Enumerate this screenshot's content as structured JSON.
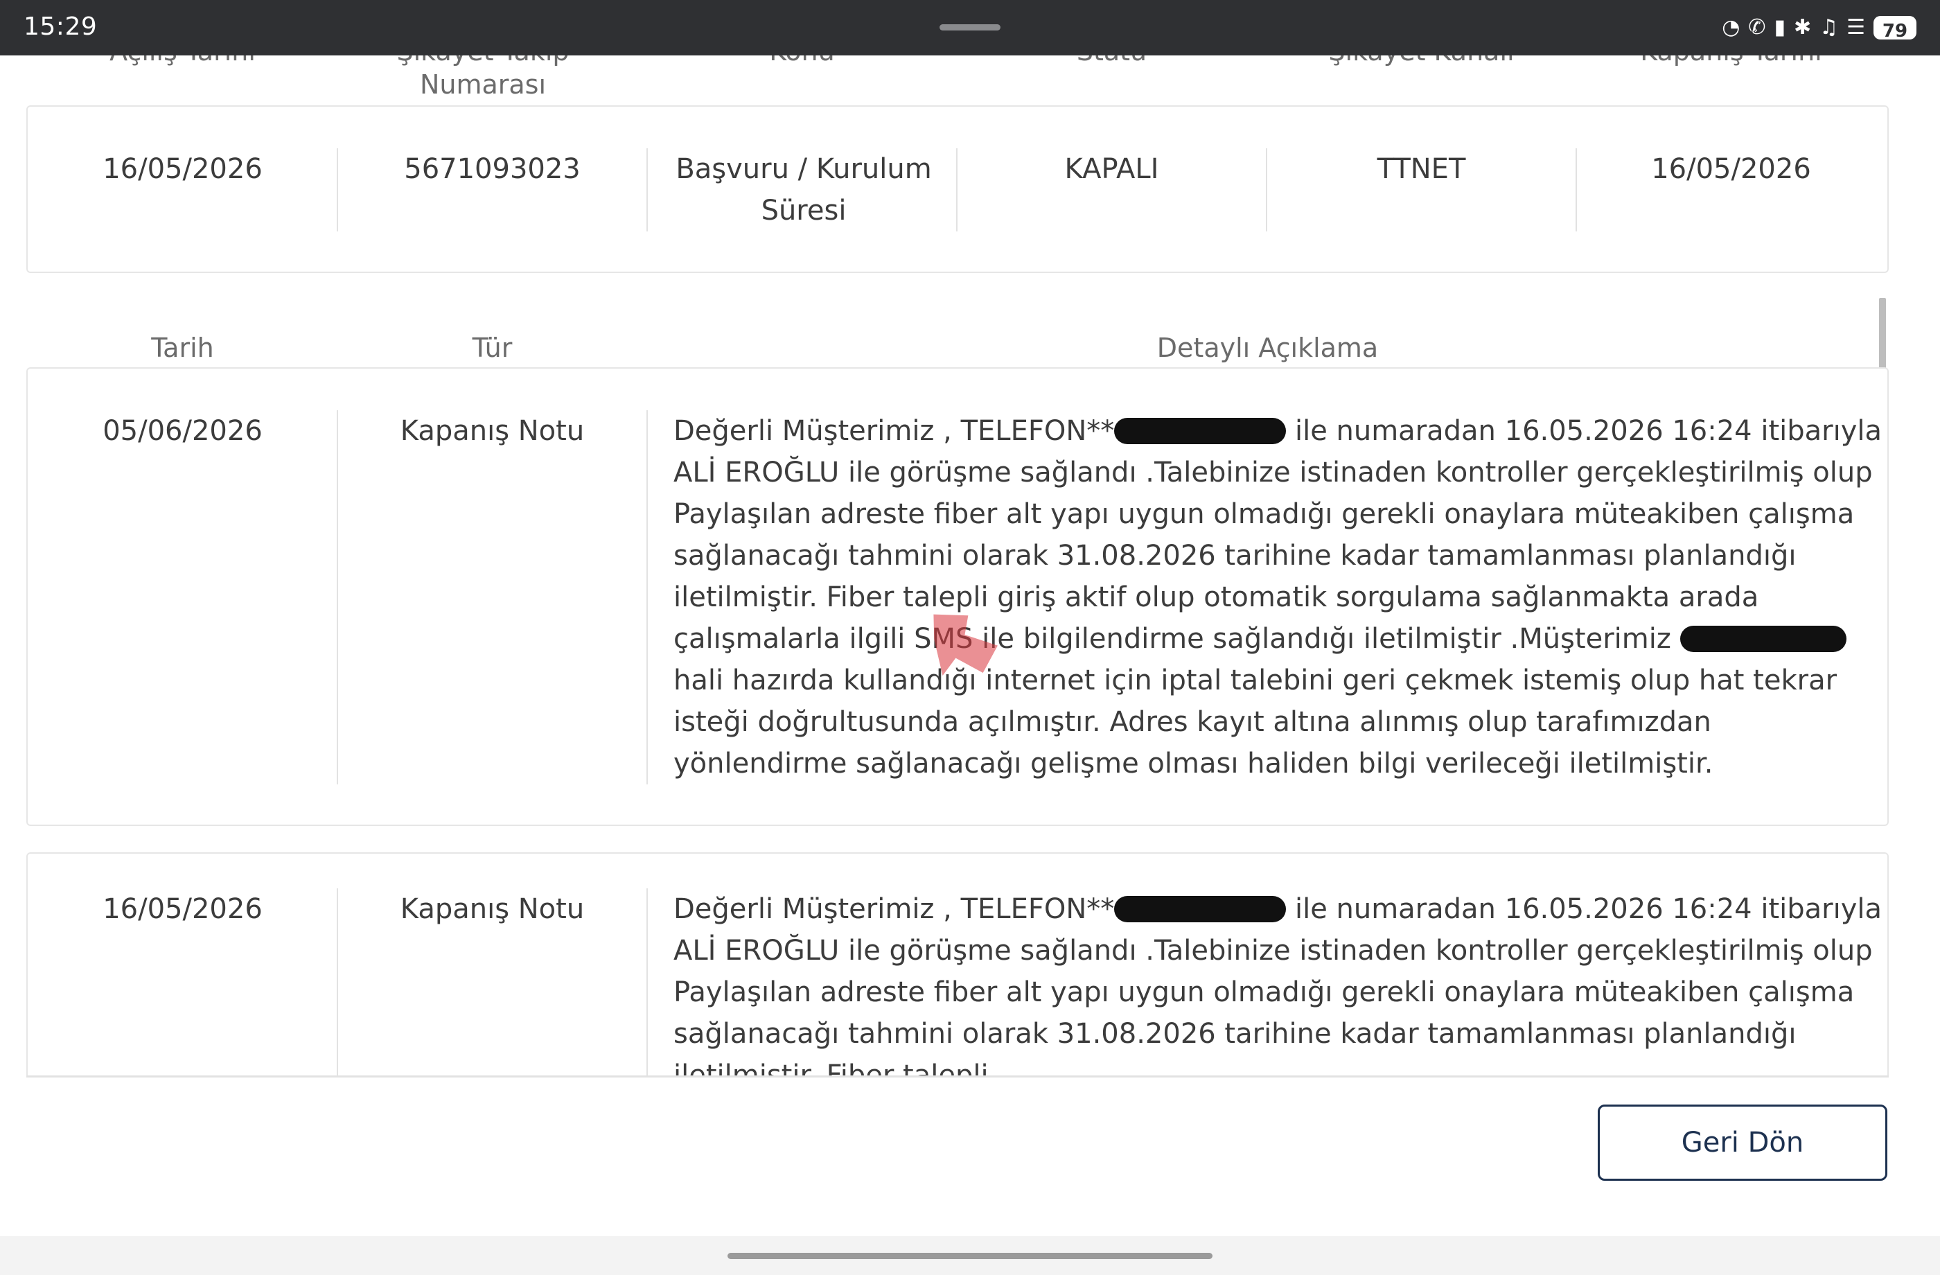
{
  "status_bar": {
    "time": "15:29",
    "icons": [
      "speedometer-icon",
      "call-wifi-icon",
      "battery-saver-icon",
      "bluetooth-icon",
      "mute-icon",
      "wifi-icon"
    ],
    "battery": "79"
  },
  "complaint_table": {
    "headers": [
      "Açılış Tarihi",
      "Şikayet Takip Numarası",
      "Konu",
      "Statü",
      "Şikayet Kanalı",
      "Kapanış Tarihi"
    ],
    "row": {
      "opening_date": "16/05/2026",
      "tracking_number": "5671093023",
      "subject": "Başvuru / Kurulum Süresi",
      "status": "KAPALI",
      "channel": "TTNET",
      "closing_date": "16/05/2026"
    }
  },
  "detail_table": {
    "headers": [
      "Tarih",
      "Tür",
      "Detaylı Açıklama"
    ],
    "rows": [
      {
        "date": "05/06/2026",
        "type": "Kapanış Notu",
        "text_a": "Değerli Müşterimiz , TELEFON**",
        "text_b": " ile numaradan 16.05.2026 16:24 itibarıyla ALİ EROĞLU ile görüşme sağlandı .Talebinize istinaden kontroller gerçekleştirilmiş olup Paylaşılan adreste fiber alt yapı uygun olmadığı gerekli onaylara müteakiben çalışma sağlanacağı tahmini olarak 31.08.2026 tarihine kadar tamamlanması planlandığı iletilmiştir. Fiber talepli giriş aktif olup otomatik sorgulama sağlanmakta arada çalışmalarla ilgili SMS ile bilgilendirme sağlandığı iletilmiştir .Müşterimiz ",
        "text_c": " hali hazırda kullandığı internet için iptal talebini geri çekmek istemiş olup hat tekrar isteği doğrultusunda açılmıştır. Adres kayıt altına alınmış olup tarafımızdan yönlendirme sağlanacağı gelişme olması haliden bilgi verileceği iletilmiştir."
      },
      {
        "date": "16/05/2026",
        "type": "Kapanış Notu",
        "text_a": "Değerli Müşterimiz , TELEFON**",
        "text_b": " ile numaradan 16.05.2026 16:24 itibarıyla ALİ EROĞLU ile görüşme sağlandı .Talebinize istinaden kontroller gerçekleştirilmiş olup Paylaşılan adreste fiber alt yapı uygun olmadığı gerekli onaylara müteakiben çalışma sağlanacağı tahmini olarak 31.08.2026 tarihine kadar tamamlanması planlandığı iletilmiştir. Fiber talepli"
      }
    ]
  },
  "back_button": "Geri Dön",
  "colors": {
    "status_bar_bg": "#2f3033",
    "button_border": "#1d3150",
    "stamp": "#d9373d"
  }
}
